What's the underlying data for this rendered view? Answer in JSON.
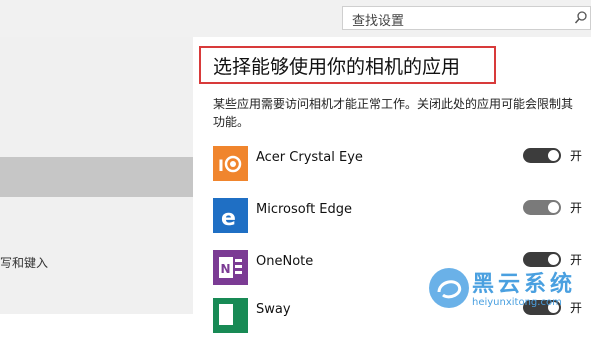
{
  "search": {
    "placeholder": "查找设置",
    "icon": "search-icon"
  },
  "sidebar": {
    "partial_label": "书写和键入"
  },
  "main": {
    "title": "选择能够使用你的相机的应用",
    "description": "某些应用需要访问相机才能正常工作。关闭此处的应用可能会限制其功能。",
    "apps": [
      {
        "name": "Acer Crystal Eye",
        "icon": "acer-crystal-eye-icon",
        "color": "#f0852d",
        "toggle_state": "on",
        "toggle_label": "开"
      },
      {
        "name": "Microsoft Edge",
        "icon": "edge-icon",
        "color": "#1f6fc4",
        "toggle_state": "on",
        "toggle_label": "开"
      },
      {
        "name": "OneNote",
        "icon": "onenote-icon",
        "color": "#7b3b94",
        "toggle_state": "on",
        "toggle_label": "开"
      },
      {
        "name": "Sway",
        "icon": "sway-icon",
        "color": "#188a55",
        "toggle_state": "on",
        "toggle_label": "开"
      }
    ]
  },
  "watermark": {
    "text": "黑云系统",
    "url": "heiyunxitong.com"
  },
  "colors": {
    "accent_red": "#d83a3a",
    "toggle_on": "#3c3c3c"
  }
}
